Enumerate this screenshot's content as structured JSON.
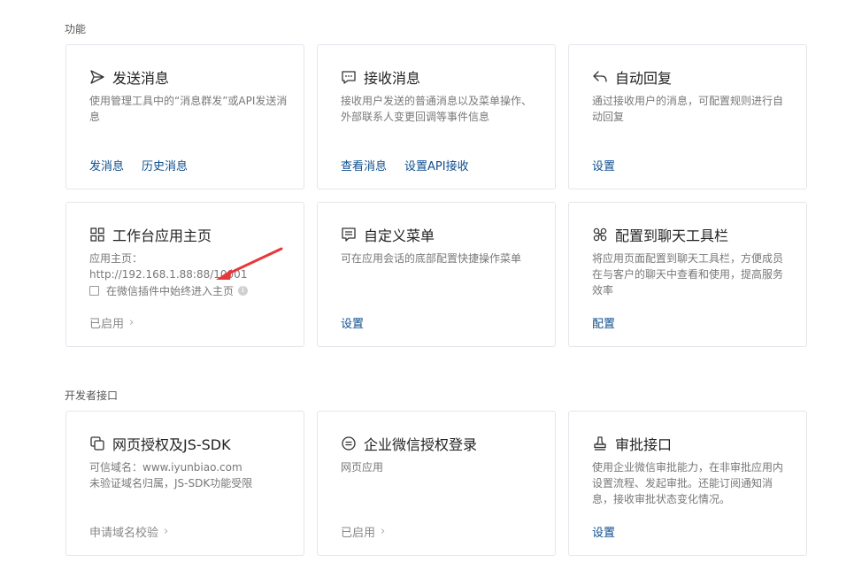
{
  "sections": {
    "features": "功能",
    "developer": "开发者接口"
  },
  "cards": {
    "send": {
      "title": "发送消息",
      "desc": "使用管理工具中的“消息群发”或API发送消息",
      "links": [
        "发消息",
        "历史消息"
      ]
    },
    "receive": {
      "title": "接收消息",
      "desc": "接收用户发送的普通消息以及菜单操作、外部联系人变更回调等事件信息",
      "links": [
        "查看消息",
        "设置API接收"
      ]
    },
    "auto_reply": {
      "title": "自动回复",
      "desc": "通过接收用户的消息，可配置规则进行自动回复",
      "links": [
        "设置"
      ]
    },
    "workbench": {
      "title": "工作台应用主页",
      "desc": "应用主页：http://192.168.1.88:88/10001",
      "checkbox_label": "在微信插件中始终进入主页",
      "status": "已启用"
    },
    "custom_menu": {
      "title": "自定义菜单",
      "desc": "可在应用会话的底部配置快捷操作菜单",
      "links": [
        "设置"
      ]
    },
    "chat_toolbar": {
      "title": "配置到聊天工具栏",
      "desc": "将应用页面配置到聊天工具栏，方便成员在与客户的聊天中查看和使用，提高服务效率",
      "links": [
        "配置"
      ]
    },
    "web_auth": {
      "title": "网页授权及JS-SDK",
      "desc_line1": "可信域名：www.iyunbiao.com",
      "desc_line2": "未验证域名归属，JS-SDK功能受限",
      "link": "申请域名校验"
    },
    "wx_login": {
      "title": "企业微信授权登录",
      "desc": "网页应用",
      "status": "已启用"
    },
    "approval": {
      "title": "审批接口",
      "desc": "使用企业微信审批能力，在非审批应用内设置流程、发起审批。还能订阅通知消息，接收审批状态变化情况。",
      "links": [
        "设置"
      ]
    }
  },
  "colors": {
    "link": "#0f4f8e",
    "arrow": "#e8373b",
    "border": "#e3e6eb"
  },
  "icons": {
    "send": "paper-plane-icon",
    "receive": "chat-bubble-icon",
    "auto_reply": "reply-arrow-icon",
    "workbench": "grid-icon",
    "custom_menu": "menu-icon",
    "chat_toolbar": "puzzle-icon",
    "web_auth": "copy-icon",
    "wx_login": "equal-circle-icon",
    "approval": "stamp-icon"
  }
}
